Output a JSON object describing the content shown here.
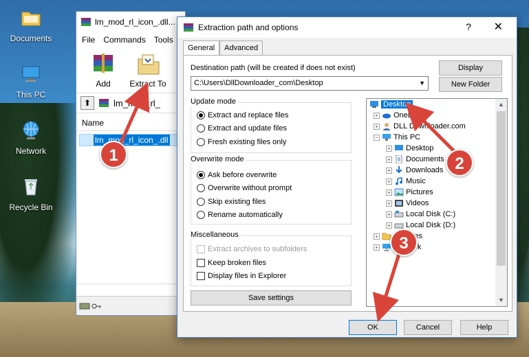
{
  "desktop": {
    "icons": [
      {
        "label": "Documents",
        "icon": "folder-icon"
      },
      {
        "label": "This PC",
        "icon": "computer-icon"
      },
      {
        "label": "Network",
        "icon": "network-icon"
      },
      {
        "label": "Recycle Bin",
        "icon": "recycle-bin-icon"
      }
    ]
  },
  "winrar": {
    "title": "lm_mod_rl_icon_.dll...",
    "menu": [
      "File",
      "Commands",
      "Tools"
    ],
    "toolbar": [
      {
        "label": "Add",
        "icon": "add-archive-icon"
      },
      {
        "label": "Extract To",
        "icon": "extract-to-icon"
      }
    ],
    "address": "lm_mod_rl_",
    "list_header": "Name",
    "file_name": "lm_mod_rl_icon_.dll"
  },
  "dialog": {
    "title": "Extraction path and options",
    "help_glyph": "?",
    "close_glyph": "✕",
    "tabs": [
      "General",
      "Advanced"
    ],
    "dest_label": "Destination path (will be created if does not exist)",
    "dest_value": "C:\\Users\\DllDownloader_com\\Desktop",
    "display_button": "Display",
    "new_folder_button": "New Folder",
    "update_mode": {
      "title": "Update mode",
      "options": [
        "Extract and replace files",
        "Extract and update files",
        "Fresh existing files only"
      ],
      "selected": 0
    },
    "overwrite_mode": {
      "title": "Overwrite mode",
      "options": [
        "Ask before overwrite",
        "Overwrite without prompt",
        "Skip existing files",
        "Rename automatically"
      ],
      "selected": 0
    },
    "misc": {
      "title": "Miscellaneous",
      "options": [
        "Extract archives to subfolders",
        "Keep broken files",
        "Display files in Explorer"
      ]
    },
    "save_settings": "Save settings",
    "ok": "OK",
    "cancel": "Cancel",
    "help": "Help",
    "tree": [
      {
        "label": "Desktop",
        "level": 0,
        "selected": true
      },
      {
        "label": "OneDrive",
        "level": 1
      },
      {
        "label": "DLL Downloader.com",
        "level": 1
      },
      {
        "label": "This PC",
        "level": 1
      },
      {
        "label": "Desktop",
        "level": 2
      },
      {
        "label": "Documents",
        "level": 2
      },
      {
        "label": "Downloads",
        "level": 2
      },
      {
        "label": "Music",
        "level": 2
      },
      {
        "label": "Pictures",
        "level": 2
      },
      {
        "label": "Videos",
        "level": 2
      },
      {
        "label": "Local Disk (C:)",
        "level": 2
      },
      {
        "label": "Local Disk (D:)",
        "level": 2
      },
      {
        "label": "Libraries",
        "level": 1
      },
      {
        "label": "Network",
        "level": 1
      }
    ]
  },
  "annotations": [
    "1",
    "2",
    "3"
  ],
  "colors": {
    "accent": "#0078d7",
    "annotation": "#d9443a"
  }
}
